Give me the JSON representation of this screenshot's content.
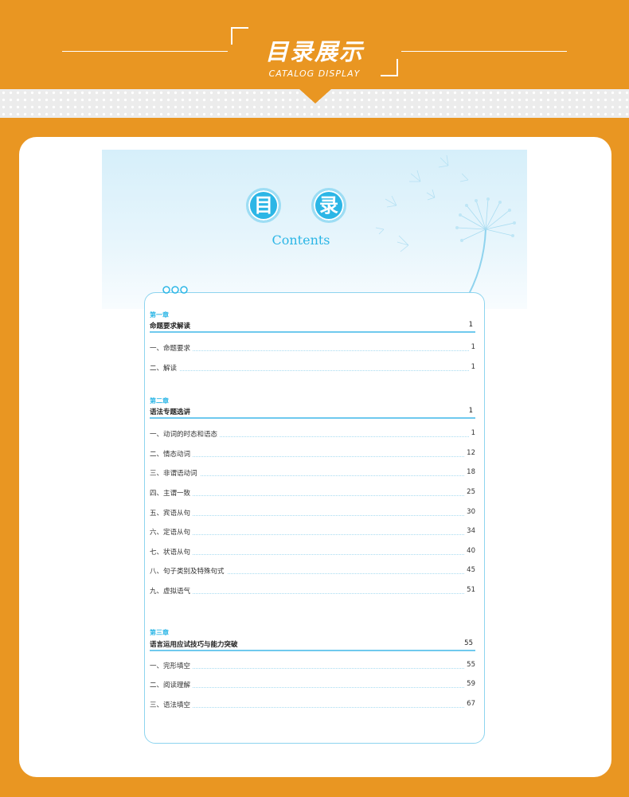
{
  "header": {
    "title": "目录展示",
    "subtitle": "CATALOG DISPLAY"
  },
  "banner": {
    "char1": "目",
    "char2": "录",
    "contents_label": "Contents"
  },
  "colors": {
    "orange": "#E99622",
    "accent_blue": "#2CB6E6",
    "border_blue": "#8DD4EF"
  },
  "toc": {
    "chapters": [
      {
        "label": "第一章",
        "title": "命题要求解读",
        "page": "1",
        "items": [
          {
            "title": "一、命题要求",
            "page": "1"
          },
          {
            "title": "二、解读",
            "page": "1"
          }
        ]
      },
      {
        "label": "第二章",
        "title": "语法专题选讲",
        "page": "1",
        "items": [
          {
            "title": "一、动词的时态和语态",
            "page": "1"
          },
          {
            "title": "二、情态动词",
            "page": "12"
          },
          {
            "title": "三、非谓语动词",
            "page": "18"
          },
          {
            "title": "四、主谓一致",
            "page": "25"
          },
          {
            "title": "五、宾语从句",
            "page": "30"
          },
          {
            "title": "六、定语从句",
            "page": "34"
          },
          {
            "title": "七、状语从句",
            "page": "40"
          },
          {
            "title": "八、句子类别及特殊句式",
            "page": "45"
          },
          {
            "title": "九、虚拟语气",
            "page": "51"
          }
        ]
      },
      {
        "label": "第三章",
        "title": "语言运用应试技巧与能力突破",
        "page": "55",
        "items": [
          {
            "title": "一、完形填空",
            "page": "55"
          },
          {
            "title": "二、阅读理解",
            "page": "59"
          },
          {
            "title": "三、语法填空",
            "page": "67"
          }
        ]
      }
    ]
  }
}
